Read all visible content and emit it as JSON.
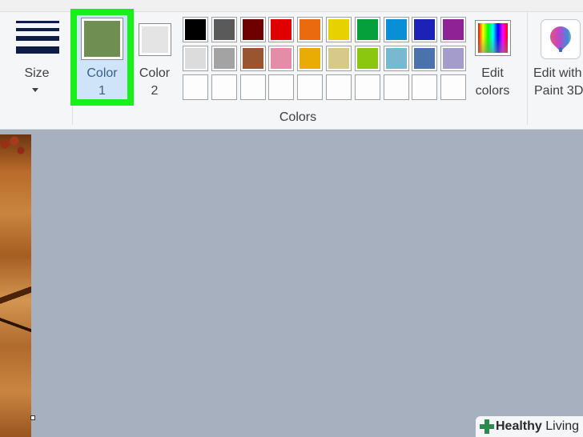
{
  "ribbon": {
    "size": {
      "label": "Size"
    },
    "color1": {
      "label_line1": "Color",
      "label_line2": "1",
      "value": "#6f8f52"
    },
    "color2": {
      "label_line1": "Color",
      "label_line2": "2",
      "value": "#e4e4e4"
    },
    "colors_group_label": "Colors",
    "palette": [
      [
        "#000000",
        "#5a5a5a",
        "#6e0000",
        "#e00000",
        "#ea6b0f",
        "#e8d100",
        "#05a03b",
        "#088fd6",
        "#1c22b5",
        "#8f2295"
      ],
      [
        "#dcdcdc",
        "#a3a3a3",
        "#995530",
        "#e38da8",
        "#e9ac05",
        "#d6c989",
        "#8bc70e",
        "#79b8d1",
        "#4b73ab",
        "#a49ccb"
      ],
      [
        "",
        "",
        "",
        "",
        "",
        "",
        "",
        "",
        "",
        ""
      ]
    ],
    "edit_colors": {
      "label_line1": "Edit",
      "label_line2": "colors"
    },
    "edit_paint3d": {
      "label_line1": "Edit with",
      "label_line2": "Paint 3D"
    }
  },
  "highlight_color": "#18f01a",
  "watermark": {
    "part1": "Healthy",
    "part2": " Living"
  }
}
